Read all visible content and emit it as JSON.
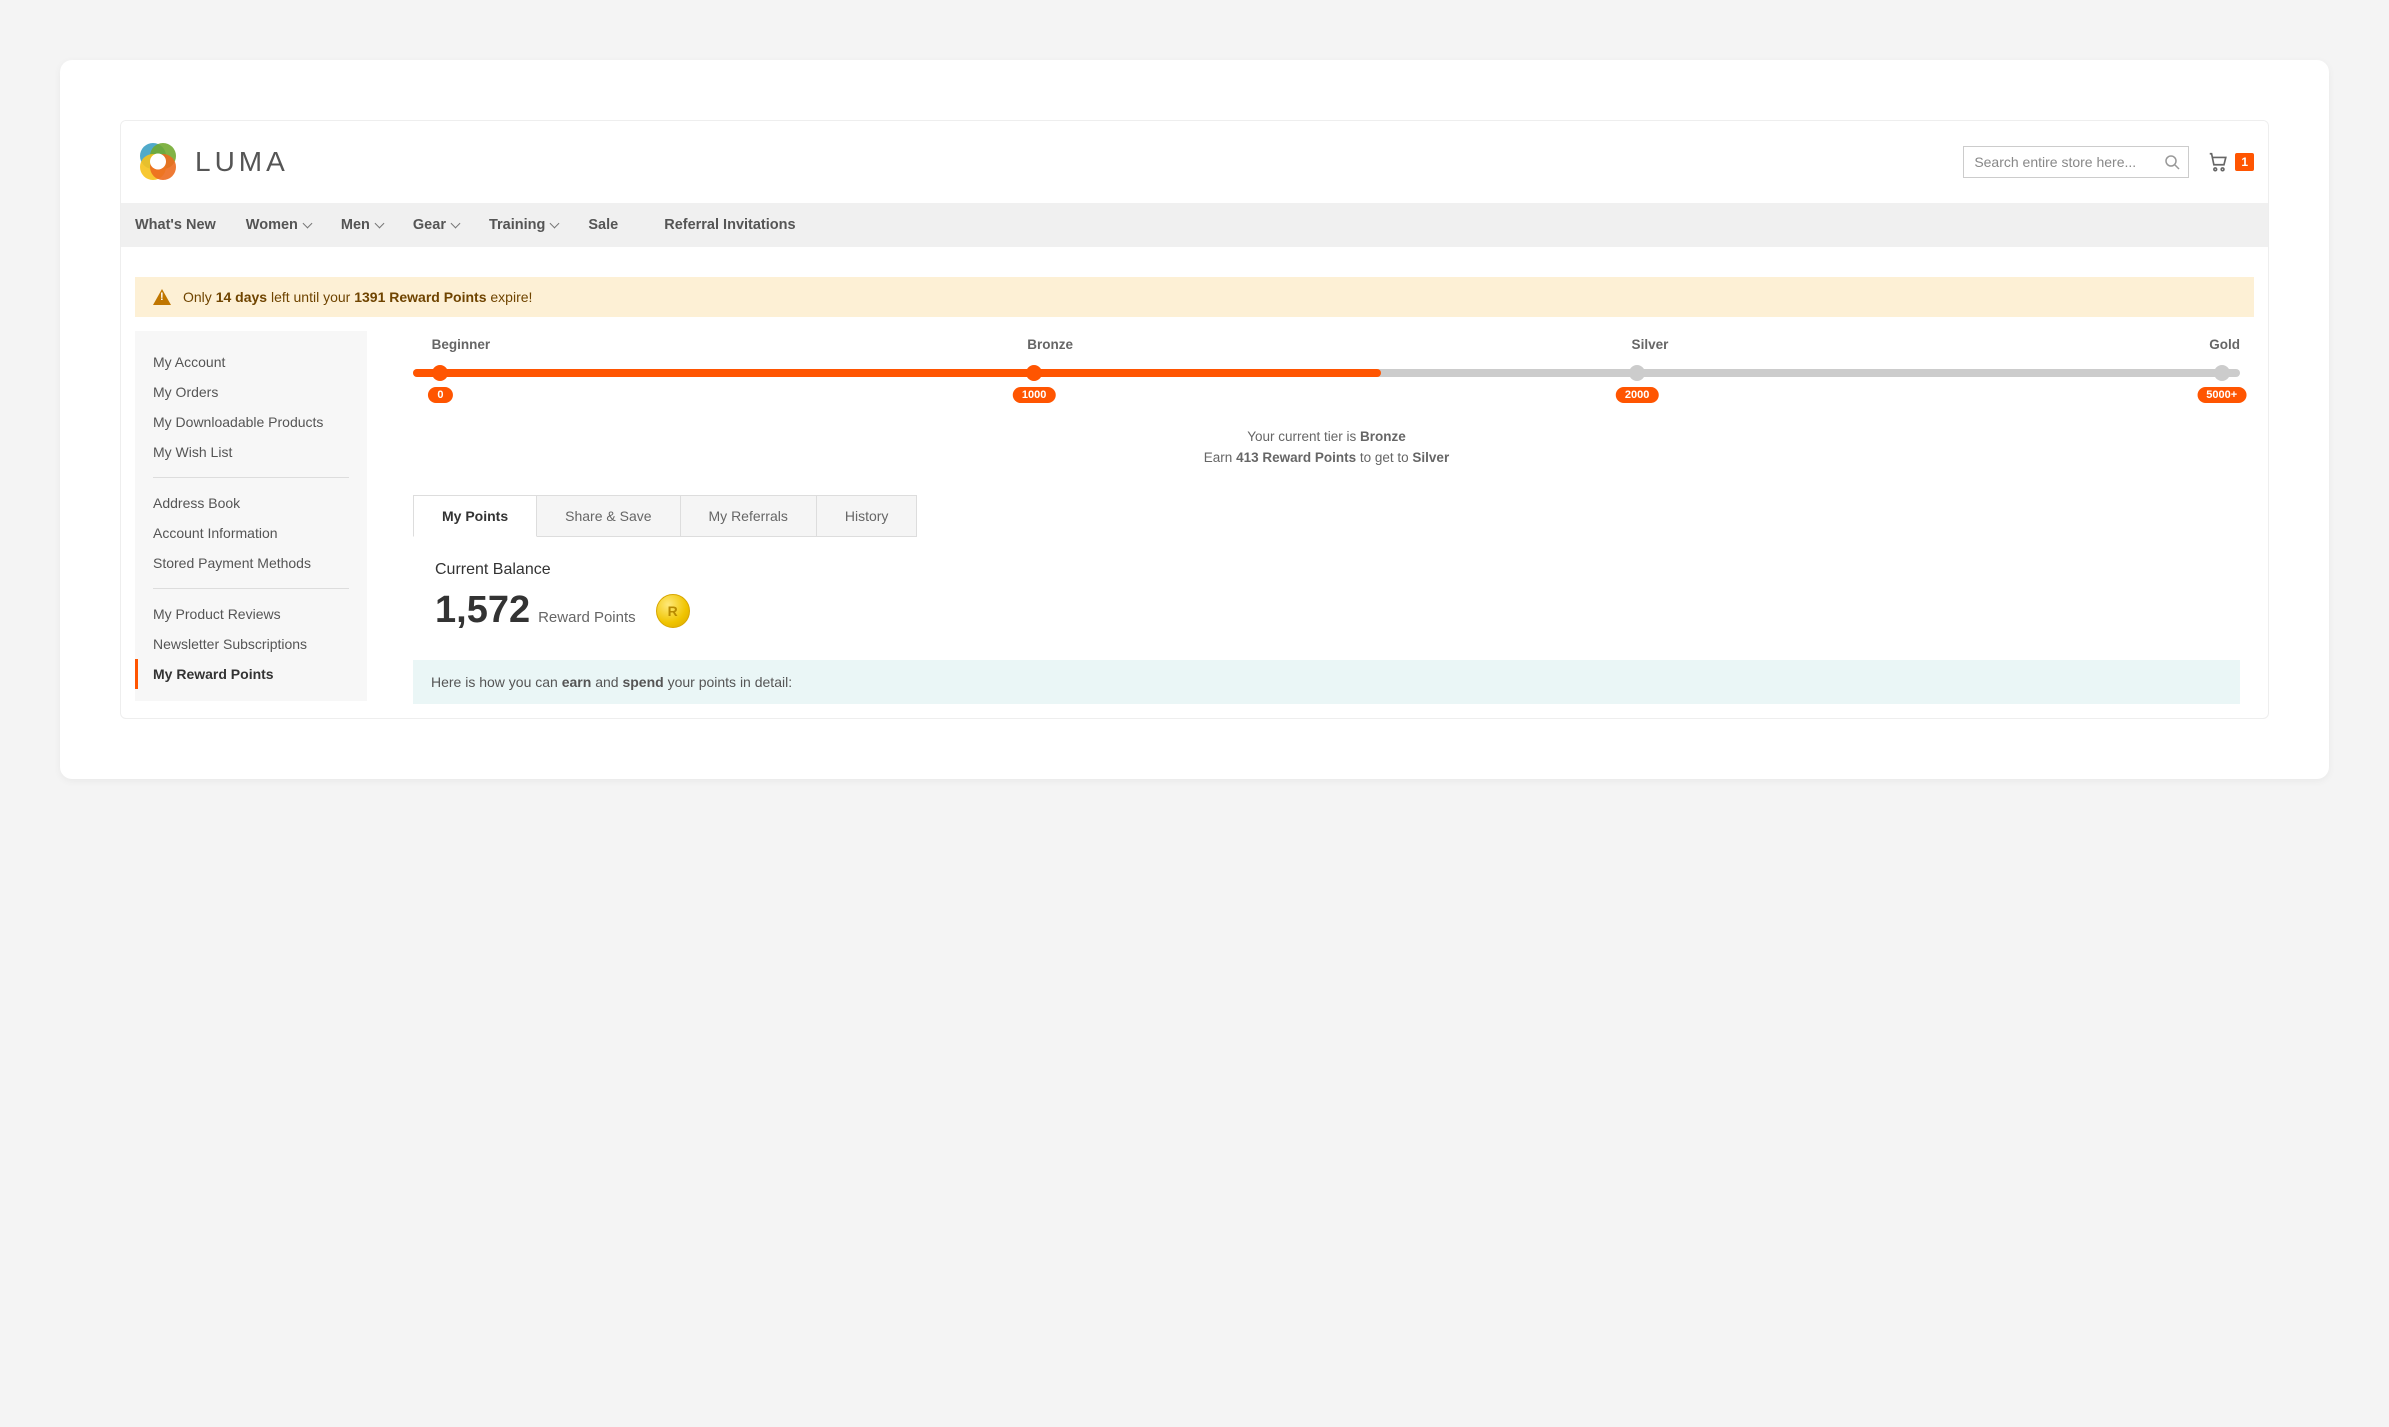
{
  "brand": {
    "name": "LUMA"
  },
  "search": {
    "placeholder": "Search entire store here..."
  },
  "cart": {
    "count": "1"
  },
  "nav": [
    {
      "label": "What's New",
      "dropdown": false
    },
    {
      "label": "Women",
      "dropdown": true
    },
    {
      "label": "Men",
      "dropdown": true
    },
    {
      "label": "Gear",
      "dropdown": true
    },
    {
      "label": "Training",
      "dropdown": true
    },
    {
      "label": "Sale",
      "dropdown": false
    },
    {
      "label": "Referral Invitations",
      "dropdown": false,
      "gapBefore": true
    }
  ],
  "alert": {
    "prefix": "Only ",
    "days": "14 days",
    "mid": " left until your ",
    "points": "1391 Reward Points",
    "suffix": " expire!"
  },
  "sidebar": {
    "groups": [
      [
        "My Account",
        "My Orders",
        "My Downloadable Products",
        "My Wish List"
      ],
      [
        "Address Book",
        "Account Information",
        "Stored Payment Methods"
      ],
      [
        "My Product Reviews",
        "Newsletter Subscriptions",
        "My Reward Points"
      ]
    ],
    "active": "My Reward Points"
  },
  "tiers": {
    "stops": [
      {
        "name": "Beginner",
        "value": "0",
        "pos": 1.5,
        "reached": true
      },
      {
        "name": "Bronze",
        "value": "1000",
        "pos": 34,
        "reached": true
      },
      {
        "name": "Silver",
        "value": "2000",
        "pos": 67,
        "reached": false
      },
      {
        "name": "Gold",
        "value": "5000+",
        "pos": 99,
        "reached": false,
        "alignLabel": "right"
      }
    ],
    "progress_pct": 53,
    "status": {
      "line1_pre": "Your current tier is ",
      "line1_tier": "Bronze",
      "line2_pre": "Earn ",
      "line2_points": "413 Reward Points",
      "line2_mid": " to get to ",
      "line2_next": "Silver"
    }
  },
  "tabs": [
    {
      "label": "My Points",
      "active": true
    },
    {
      "label": "Share & Save"
    },
    {
      "label": "My Referrals"
    },
    {
      "label": "History"
    }
  ],
  "balance": {
    "title": "Current Balance",
    "value": "1,572",
    "unit": "Reward Points"
  },
  "info": {
    "pre": "Here is how you can ",
    "b1": "earn",
    "mid": " and ",
    "b2": "spend",
    "post": " your points in detail:"
  }
}
